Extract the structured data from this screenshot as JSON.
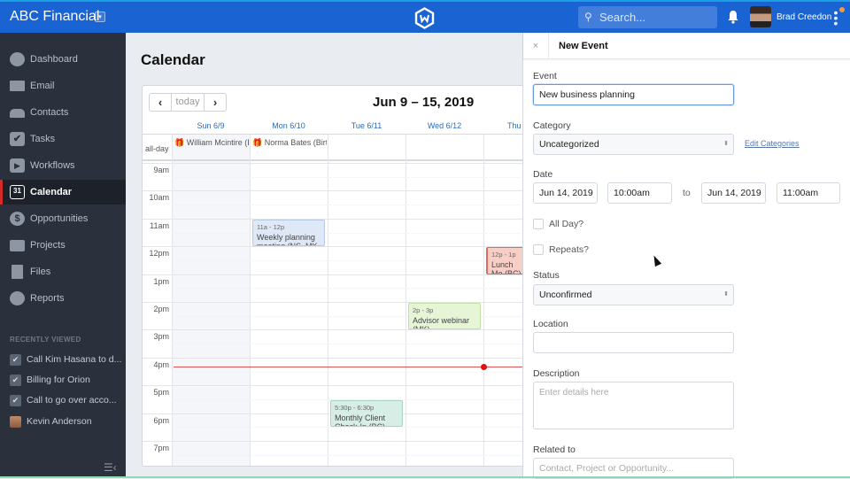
{
  "topbar": {
    "brand": "ABC Financial",
    "brand_dropdown_icon": "chevron-down-icon",
    "logo_icon": "hexagon-w-logo-icon",
    "search_placeholder": "Search...",
    "search_icon": "⌕",
    "bell_icon": "bell-icon",
    "user_name": "Brad Creedon",
    "kebab_icon": "⋮",
    "accent_color": "#1a63d2"
  },
  "sidebar": {
    "items": [
      {
        "label": "Dashboard",
        "icon": "dashboard-icon"
      },
      {
        "label": "Email",
        "icon": "envelope-icon"
      },
      {
        "label": "Contacts",
        "icon": "contacts-icon"
      },
      {
        "label": "Tasks",
        "icon": "checkbox-icon"
      },
      {
        "label": "Workflows",
        "icon": "play-icon"
      },
      {
        "label": "Calendar",
        "icon": "calendar-icon",
        "active": true,
        "icon_text": "31"
      },
      {
        "label": "Opportunities",
        "icon": "dollar-icon"
      },
      {
        "label": "Projects",
        "icon": "briefcase-icon"
      },
      {
        "label": "Files",
        "icon": "files-icon"
      },
      {
        "label": "Reports",
        "icon": "pie-chart-icon"
      }
    ],
    "recently_viewed_title": "RECENTLY VIEWED",
    "recently_viewed": [
      {
        "label": "Call Kim Hasana to d...",
        "type": "task"
      },
      {
        "label": "Billing for Orion",
        "type": "task"
      },
      {
        "label": "Call to go over acco...",
        "type": "task"
      },
      {
        "label": "Kevin Anderson",
        "type": "contact"
      }
    ],
    "collapse_icon": "☰‹"
  },
  "main": {
    "title": "Calendar",
    "calendar": {
      "prev": "‹",
      "today": "today",
      "next": "›",
      "range": "Jun 9 – 15, 2019",
      "days": [
        "Sun 6/9",
        "Mon 6/10",
        "Tue 6/11",
        "Wed 6/12",
        "Thu"
      ],
      "allday_label": "all-day",
      "allday_events": [
        {
          "day": 0,
          "label": "🎁 William Mcintire (B"
        },
        {
          "day": 1,
          "label": "🎁 Norma Bates (Birth"
        }
      ],
      "hours": [
        "9am",
        "10am",
        "11am",
        "12pm",
        "1pm",
        "2pm",
        "3pm",
        "4pm",
        "5pm",
        "6pm",
        "7pm"
      ],
      "events": [
        {
          "day": 1,
          "time": "11a - 12p",
          "title": "Weekly planning meeting (NS, MK",
          "color": "#dfe8f7",
          "border": "#b7c8e4"
        },
        {
          "day": 4,
          "time": "12p - 1p",
          "title": "Lunch Me (BC)",
          "color": "#f8cfc7",
          "border": "#e06a5e"
        },
        {
          "day": 3,
          "time": "2p - 3p",
          "title": "Advisor webinar (MK)",
          "color": "#e5f5d6",
          "border": "#bfe0a6"
        },
        {
          "day": 2,
          "time": "5:30p - 6:30p",
          "title": "Monthly Client Check-In (BC)",
          "color": "#d7eee6",
          "border": "#a9d4c4"
        }
      ],
      "now_indicator": "4:20pm"
    }
  },
  "panel": {
    "close": "×",
    "title": "New Event",
    "event_label": "Event",
    "event_value": "New business planning",
    "category_label": "Category",
    "category_value": "Uncategorized",
    "edit_categories": "Edit Categories",
    "date_label": "Date",
    "start_date": "Jun 14, 2019",
    "start_time": "10:00am",
    "to": "to",
    "end_date": "Jun 14, 2019",
    "end_time": "11:00am",
    "all_day_label": "All Day?",
    "repeats_label": "Repeats?",
    "status_label": "Status",
    "status_value": "Unconfirmed",
    "location_label": "Location",
    "location_value": "",
    "description_label": "Description",
    "description_placeholder": "Enter details here",
    "related_label": "Related to",
    "related_placeholder": "Contact, Project or Opportunity..."
  }
}
